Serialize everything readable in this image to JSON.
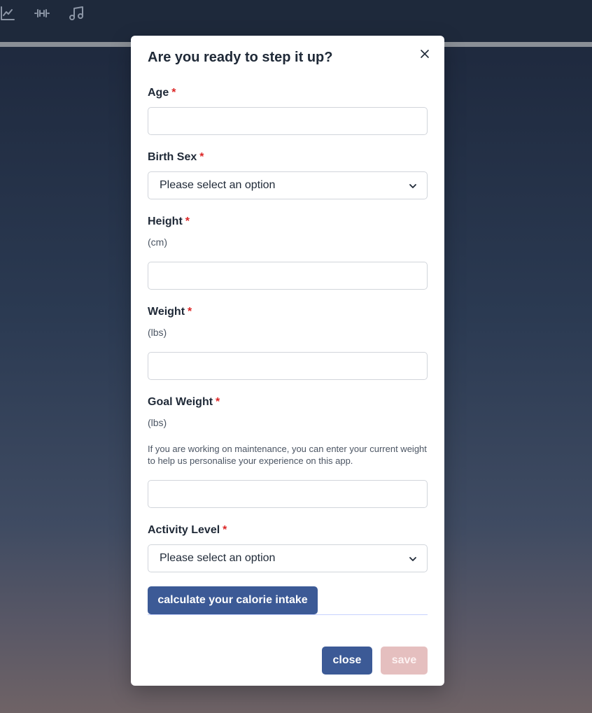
{
  "nav": {
    "icons": [
      "chart-line-icon",
      "dumbbell-icon",
      "music-note-icon"
    ]
  },
  "modal": {
    "title": "Are you ready to step it up?",
    "required_marker": "*",
    "fields": {
      "age": {
        "label": "Age",
        "value": ""
      },
      "birth_sex": {
        "label": "Birth Sex",
        "selected": "Please select an option"
      },
      "height": {
        "label": "Height",
        "unit": "(cm)",
        "value": ""
      },
      "weight": {
        "label": "Weight",
        "unit": "(lbs)",
        "value": ""
      },
      "goal_weight": {
        "label": "Goal Weight",
        "unit": "(lbs)",
        "help": "If you are working on maintenance, you can enter your current weight to help us personalise your experience on this app.",
        "value": ""
      },
      "activity_level": {
        "label": "Activity Level",
        "selected": "Please select an option"
      }
    },
    "calculate_label": "calculate your calorie intake",
    "close_label": "close",
    "save_label": "save"
  },
  "colors": {
    "primary": "#3c5a96",
    "required": "#dc2626",
    "save_disabled": "#e5bfbf"
  }
}
